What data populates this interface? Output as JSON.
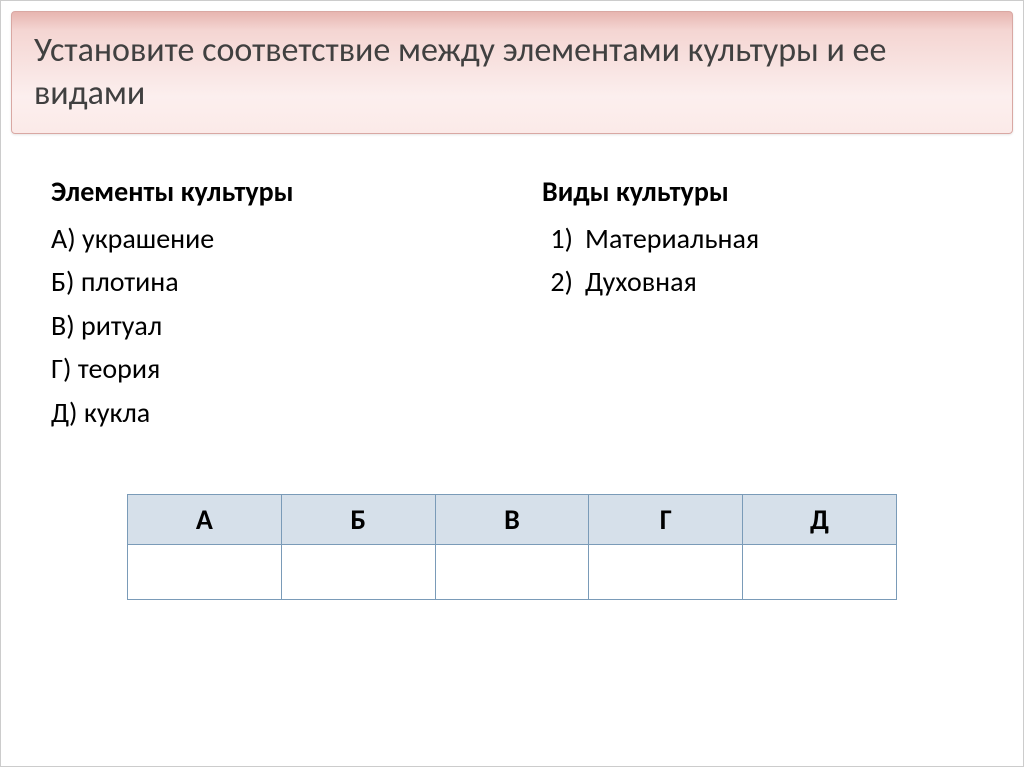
{
  "title": "Установите соответствие между элементами культуры и ее видами",
  "left": {
    "heading": "Элементы культуры",
    "items": [
      "А) украшение",
      "Б) плотина",
      "В) ритуал",
      "Г) теория",
      "Д) кукла"
    ]
  },
  "right": {
    "heading": "Виды культуры",
    "items": [
      {
        "num": "1)",
        "text": "Материальная"
      },
      {
        "num": "2)",
        "text": "Духовная"
      }
    ]
  },
  "table": {
    "headers": [
      "А",
      "Б",
      "В",
      "Г",
      "Д"
    ],
    "answers": [
      "",
      "",
      "",
      "",
      ""
    ]
  }
}
